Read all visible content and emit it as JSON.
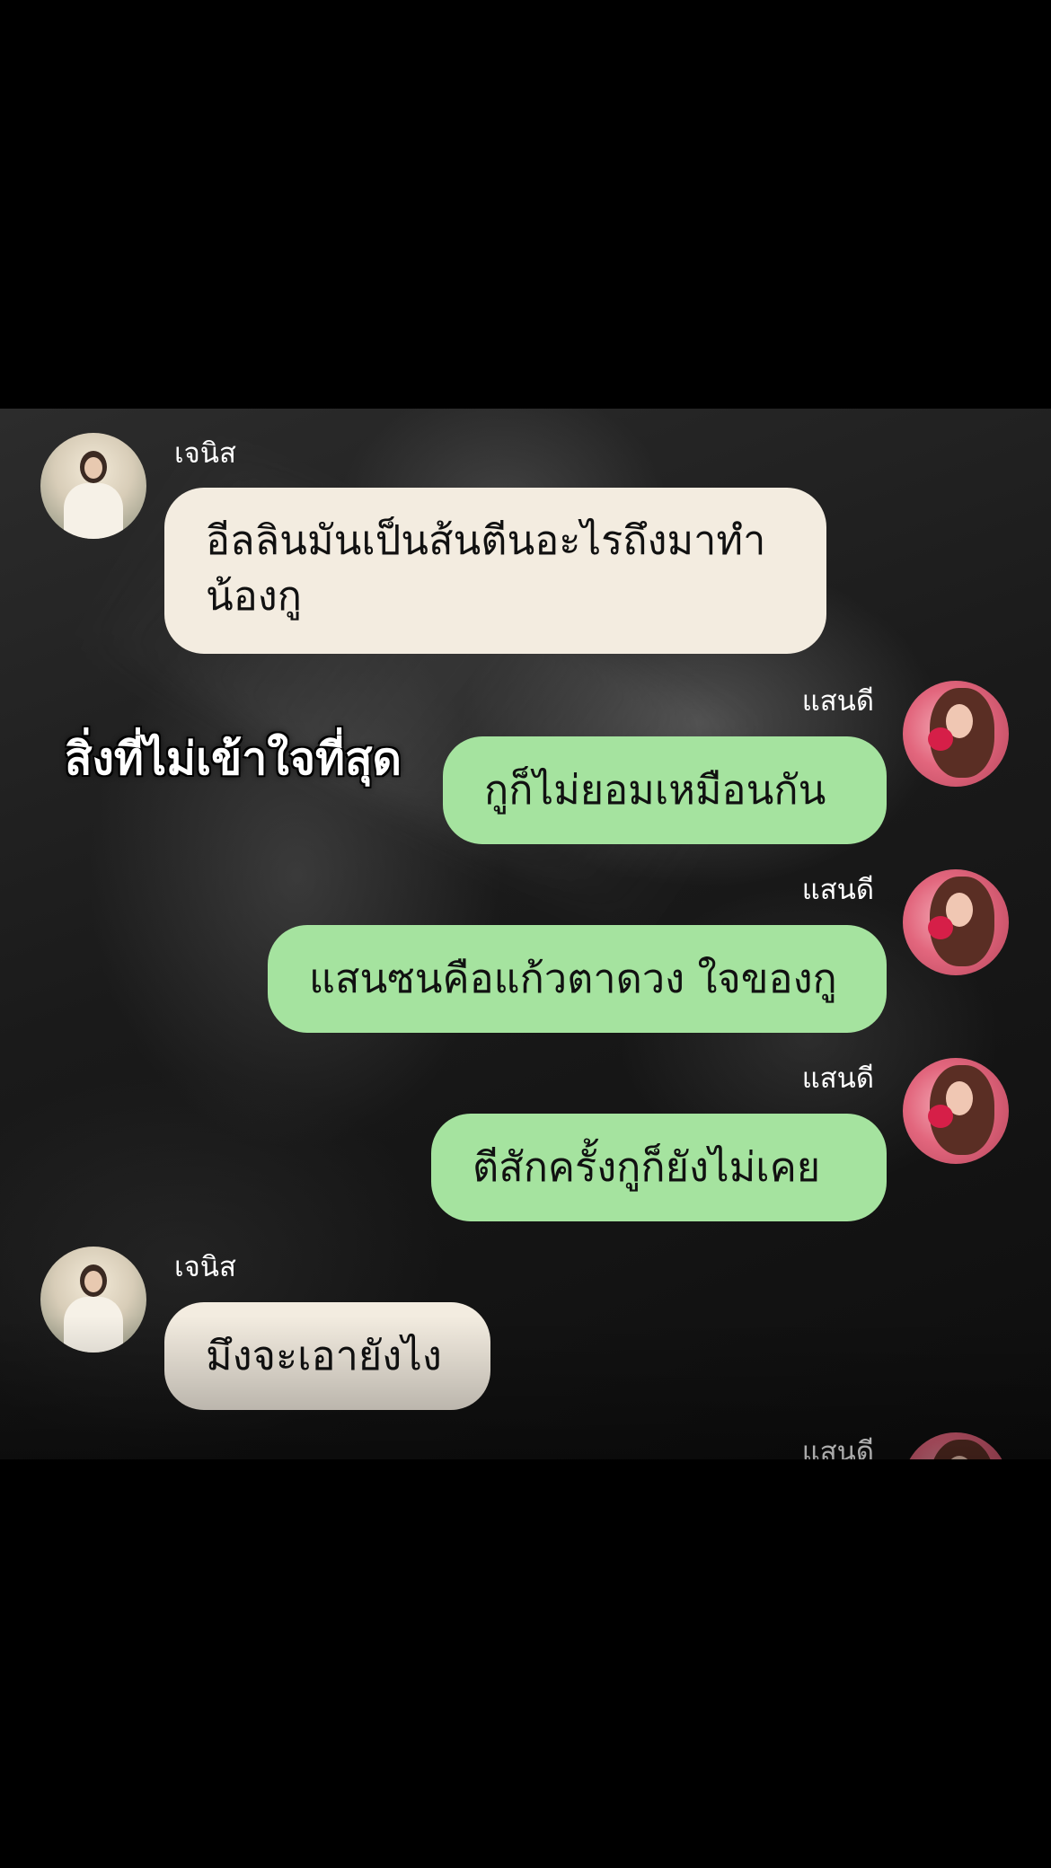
{
  "chat": {
    "messages": [
      {
        "sender": "เจนิส",
        "side": "left",
        "text_lines": [
          "อีลลินมันเป็นส้นตีนอะไรถึงมาทำ",
          "น้องกู"
        ]
      },
      {
        "sender": "แสนดี",
        "side": "right",
        "text": "กูก็ไม่ยอมเหมือนกัน"
      },
      {
        "sender": "แสนดี",
        "side": "right",
        "text": "แสนซนคือแก้วตาดวง ใจของกู"
      },
      {
        "sender": "แสนดี",
        "side": "right",
        "text": "ตีสักครั้งกูก็ยังไม่เคย"
      },
      {
        "sender": "เจนิส",
        "side": "left",
        "text": "มึงจะเอายังไง"
      },
      {
        "sender": "แสนดี",
        "side": "right",
        "text": ""
      }
    ]
  },
  "overlay": {
    "caption": "สิ่งที่ไม่เข้าใจที่สุด"
  },
  "colors": {
    "page_background": "#000000",
    "incoming_bubble": "#f3ece0",
    "outgoing_bubble": "#a5e39f",
    "text_light": "#ffffff"
  }
}
